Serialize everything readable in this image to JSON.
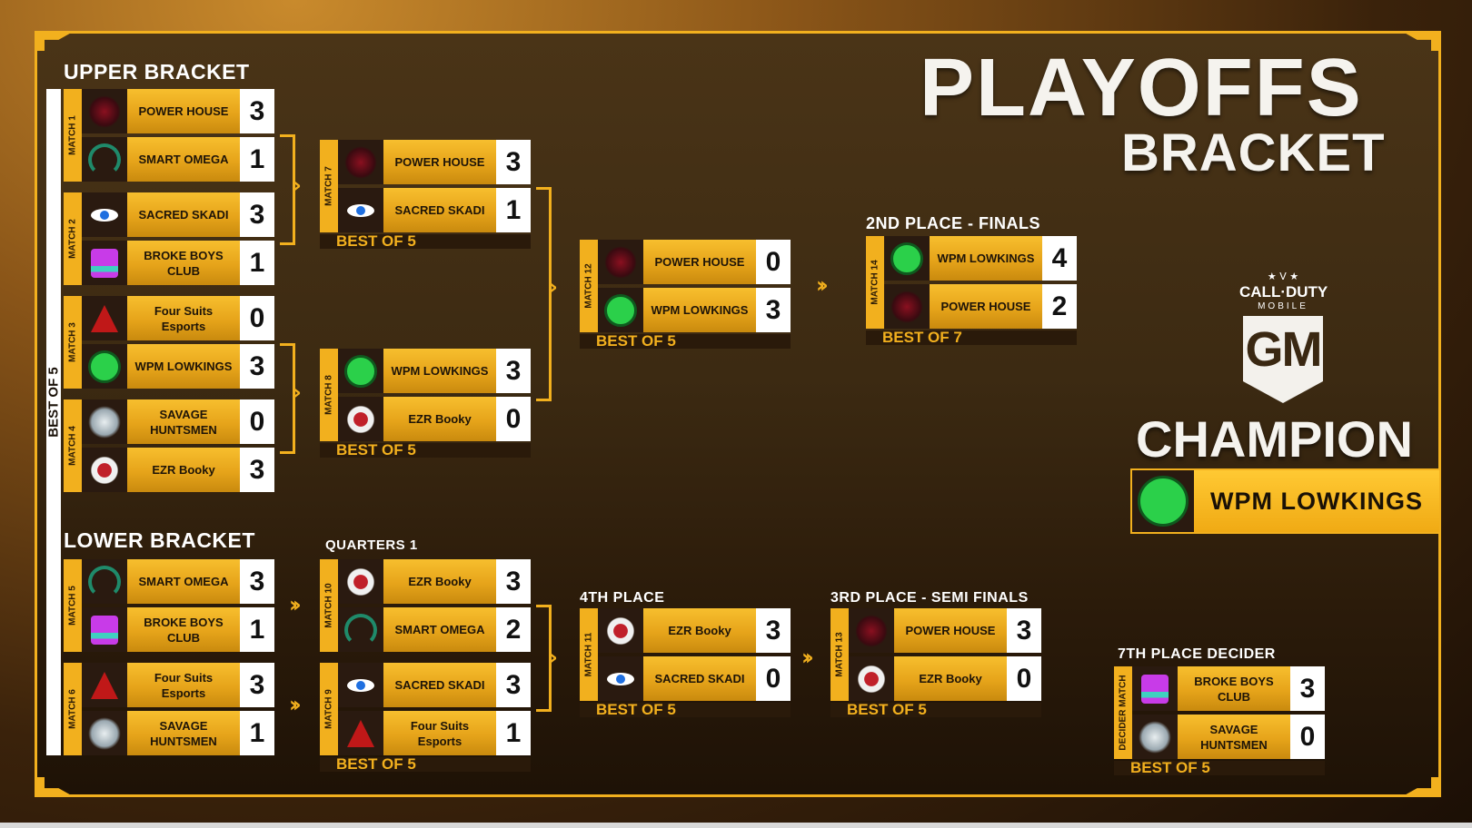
{
  "title": {
    "line1": "PLAYOFFS",
    "line2": "BRACKET"
  },
  "logo": {
    "stars": "★ V ★",
    "brand": "CALL·DUTY",
    "sub": "MOBILE",
    "mark": "GM"
  },
  "upper_bracket": {
    "heading": "UPPER BRACKET",
    "side_label": "BEST OF 5",
    "matches": [
      {
        "label": "MATCH 1",
        "teams": [
          {
            "name": "POWER HOUSE",
            "score": "3",
            "logo": "power-house"
          },
          {
            "name": "SMART OMEGA",
            "score": "1",
            "logo": "smart-omega"
          }
        ]
      },
      {
        "label": "MATCH 2",
        "teams": [
          {
            "name": "SACRED SKADI",
            "score": "3",
            "logo": "sacred-skadi"
          },
          {
            "name": "BROKE BOYS CLUB",
            "score": "1",
            "logo": "broke-boys-club"
          }
        ]
      },
      {
        "label": "MATCH 3",
        "teams": [
          {
            "name": "Four Suits Esports",
            "score": "0",
            "logo": "four-suits"
          },
          {
            "name": "WPM LOWKINGS",
            "score": "3",
            "logo": "wpm-lowkings"
          }
        ]
      },
      {
        "label": "MATCH 4",
        "teams": [
          {
            "name": "SAVAGE HUNTSMEN",
            "score": "0",
            "logo": "savage-huntsmen"
          },
          {
            "name": "EZR Booky",
            "score": "3",
            "logo": "ezr-booky"
          }
        ]
      },
      {
        "label": "MATCH 7",
        "best_of": "BEST OF 5",
        "teams": [
          {
            "name": "POWER HOUSE",
            "score": "3",
            "logo": "power-house"
          },
          {
            "name": "SACRED SKADI",
            "score": "1",
            "logo": "sacred-skadi"
          }
        ]
      },
      {
        "label": "MATCH 8",
        "best_of": "BEST OF 5",
        "teams": [
          {
            "name": "WPM LOWKINGS",
            "score": "3",
            "logo": "wpm-lowkings"
          },
          {
            "name": "EZR Booky",
            "score": "0",
            "logo": "ezr-booky"
          }
        ]
      },
      {
        "label": "MATCH 12",
        "best_of": "BEST OF 5",
        "teams": [
          {
            "name": "POWER HOUSE",
            "score": "0",
            "logo": "power-house"
          },
          {
            "name": "WPM LOWKINGS",
            "score": "3",
            "logo": "wpm-lowkings"
          }
        ]
      }
    ]
  },
  "finals": {
    "heading": "2ND PLACE - FINALS",
    "label": "MATCH 14",
    "best_of": "BEST OF 7",
    "teams": [
      {
        "name": "WPM LOWKINGS",
        "score": "4",
        "logo": "wpm-lowkings"
      },
      {
        "name": "POWER HOUSE",
        "score": "2",
        "logo": "power-house"
      }
    ]
  },
  "lower_bracket": {
    "heading": "LOWER BRACKET",
    "quarters_heading": "QUARTERS 1",
    "matches": [
      {
        "label": "MATCH 5",
        "teams": [
          {
            "name": "SMART OMEGA",
            "score": "3",
            "logo": "smart-omega"
          },
          {
            "name": "BROKE BOYS CLUB",
            "score": "1",
            "logo": "broke-boys-club"
          }
        ]
      },
      {
        "label": "MATCH 6",
        "teams": [
          {
            "name": "Four Suits Esports",
            "score": "3",
            "logo": "four-suits"
          },
          {
            "name": "SAVAGE HUNTSMEN",
            "score": "1",
            "logo": "savage-huntsmen"
          }
        ]
      },
      {
        "label": "MATCH 10",
        "teams": [
          {
            "name": "EZR Booky",
            "score": "3",
            "logo": "ezr-booky"
          },
          {
            "name": "SMART OMEGA",
            "score": "2",
            "logo": "smart-omega"
          }
        ]
      },
      {
        "label": "MATCH 9",
        "best_of": "BEST OF 5",
        "teams": [
          {
            "name": "SACRED SKADI",
            "score": "3",
            "logo": "sacred-skadi"
          },
          {
            "name": "Four Suits Esports",
            "score": "1",
            "logo": "four-suits"
          }
        ]
      }
    ]
  },
  "fourth_place": {
    "heading": "4TH PLACE",
    "label": "MATCH 11",
    "best_of": "BEST OF 5",
    "teams": [
      {
        "name": "EZR Booky",
        "score": "3",
        "logo": "ezr-booky"
      },
      {
        "name": "SACRED SKADI",
        "score": "0",
        "logo": "sacred-skadi"
      }
    ]
  },
  "third_place": {
    "heading": "3RD PLACE - SEMI FINALS",
    "label": "MATCH 13",
    "best_of": "BEST OF 5",
    "teams": [
      {
        "name": "POWER HOUSE",
        "score": "3",
        "logo": "power-house"
      },
      {
        "name": "EZR Booky",
        "score": "0",
        "logo": "ezr-booky"
      }
    ]
  },
  "seventh_place": {
    "heading": "7TH PLACE DECIDER",
    "label": "DECIDER MATCH",
    "best_of": "BEST OF 5",
    "teams": [
      {
        "name": "BROKE BOYS CLUB",
        "score": "3",
        "logo": "broke-boys-club"
      },
      {
        "name": "SAVAGE HUNTSMEN",
        "score": "0",
        "logo": "savage-huntsmen"
      }
    ]
  },
  "champion": {
    "heading": "CHAMPION",
    "name": "WPM LOWKINGS",
    "logo": "wpm-lowkings"
  },
  "colors": {
    "accent": "#f2b01e",
    "panel": "#3c2a12",
    "score_bg": "#ffffff",
    "text_dark": "#1e1408"
  }
}
